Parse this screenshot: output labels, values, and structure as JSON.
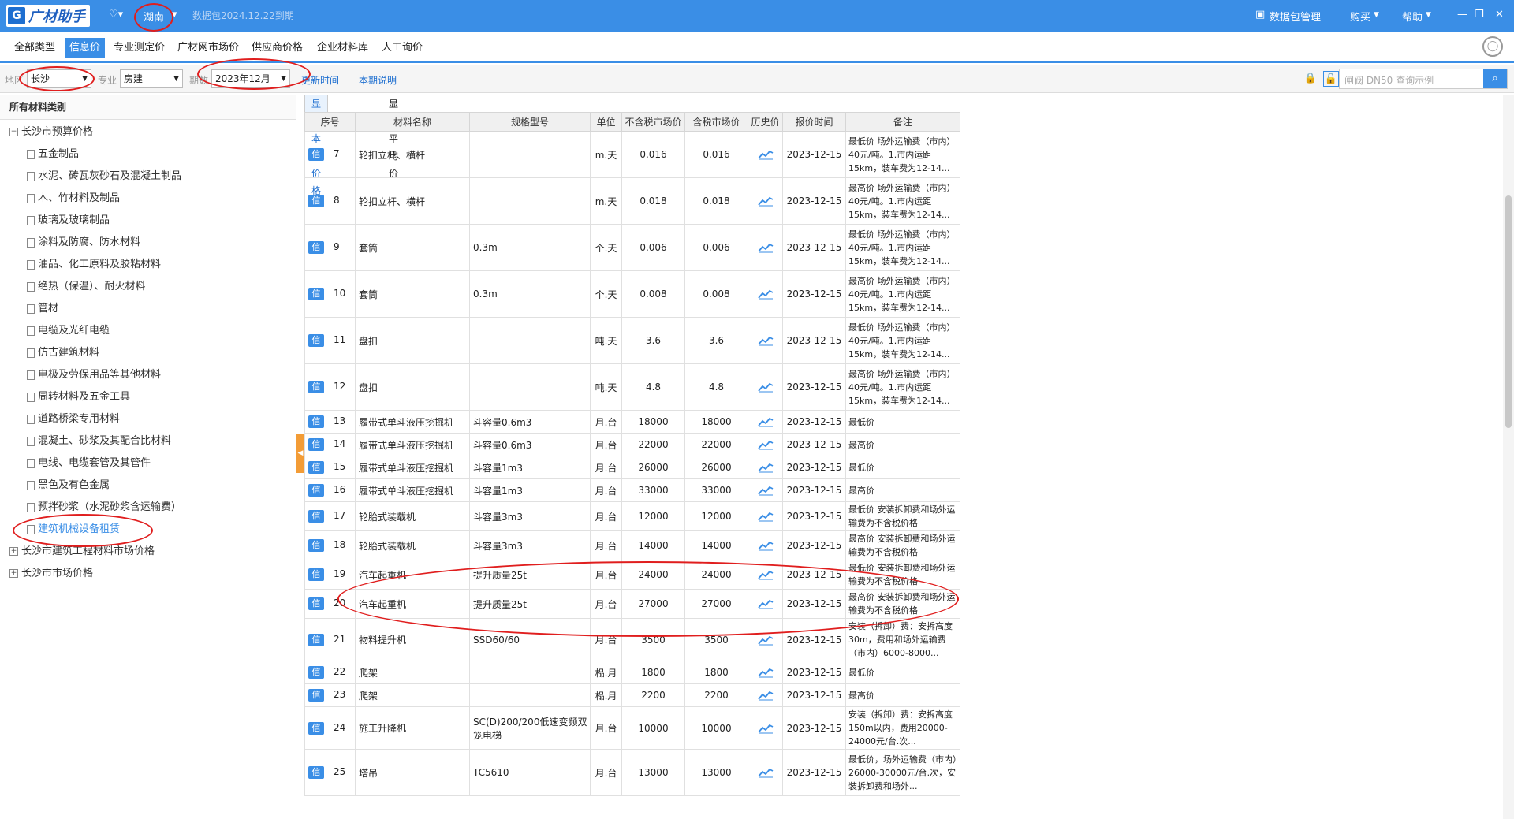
{
  "titlebar": {
    "app_name": "广材助手",
    "province": "湖南",
    "expire_text": "数据包2024.12.22到期",
    "pkg_mgmt": "数据包管理",
    "buy": "购买",
    "help": "帮助"
  },
  "menu": {
    "tabs": [
      {
        "label": "全部类型",
        "active": false
      },
      {
        "label": "信息价",
        "active": true
      },
      {
        "label": "专业测定价",
        "active": false
      },
      {
        "label": "广材网市场价",
        "active": false
      },
      {
        "label": "供应商价格",
        "active": false
      },
      {
        "label": "企业材料库",
        "active": false
      },
      {
        "label": "人工询价",
        "active": false
      }
    ]
  },
  "filters": {
    "region_label": "地区",
    "region_value": "长沙",
    "major_label": "专业",
    "major_value": "房建",
    "period_label": "期数",
    "period_value": "2023年12月",
    "update_time_link": "更新时间",
    "period_note_link": "本期说明",
    "search_placeholder": "闸阀 DN50 查询示例"
  },
  "sidebar": {
    "header": "所有材料类别",
    "root1": "长沙市预算价格",
    "items": [
      "五金制品",
      "水泥、砖瓦灰砂石及混凝土制品",
      "木、竹材料及制品",
      "玻璃及玻璃制品",
      "涂料及防腐、防水材料",
      "油品、化工原料及胶粘材料",
      "绝热（保温）、耐火材料",
      "管材",
      "电缆及光纤电缆",
      "仿古建筑材料",
      "电极及劳保用品等其他材料",
      "周转材料及五金工具",
      "道路桥梁专用材料",
      "混凝土、砂浆及其配合比材料",
      "电线、电缆套管及其管件",
      "黑色及有色金属",
      "预拌砂浆（水泥砂浆含运输费）",
      "建筑机械设备租赁"
    ],
    "selected_index": 17,
    "root2": "长沙市建筑工程材料市场价格",
    "root3": "长沙市市场价格"
  },
  "subtabs": {
    "current": "显示本期价格",
    "average": "显示平均价"
  },
  "table": {
    "headers": [
      "序号",
      "材料名称",
      "规格型号",
      "单位",
      "不含税市场价",
      "含税市场价",
      "历史价",
      "报价时间",
      "备注"
    ],
    "badge": "信",
    "rows": [
      {
        "no": "7",
        "name": "轮扣立杆、横杆",
        "spec": "",
        "unit": "m.天",
        "price_ex": "0.016",
        "price_in": "0.016",
        "date": "2023-12-15",
        "note": "最低价 场外运输费（市内）40元/吨。1.市内运距15km，装车费为12-14..."
      },
      {
        "no": "8",
        "name": "轮扣立杆、横杆",
        "spec": "",
        "unit": "m.天",
        "price_ex": "0.018",
        "price_in": "0.018",
        "date": "2023-12-15",
        "note": "最高价 场外运输费（市内）40元/吨。1.市内运距15km，装车费为12-14..."
      },
      {
        "no": "9",
        "name": "套筒",
        "spec": "0.3m",
        "unit": "个.天",
        "price_ex": "0.006",
        "price_in": "0.006",
        "date": "2023-12-15",
        "note": "最低价 场外运输费（市内）40元/吨。1.市内运距15km，装车费为12-14..."
      },
      {
        "no": "10",
        "name": "套筒",
        "spec": "0.3m",
        "unit": "个.天",
        "price_ex": "0.008",
        "price_in": "0.008",
        "date": "2023-12-15",
        "note": "最高价 场外运输费（市内）40元/吨。1.市内运距15km，装车费为12-14..."
      },
      {
        "no": "11",
        "name": "盘扣",
        "spec": "",
        "unit": "吨.天",
        "price_ex": "3.6",
        "price_in": "3.6",
        "date": "2023-12-15",
        "note": "最低价 场外运输费（市内）40元/吨。1.市内运距15km，装车费为12-14..."
      },
      {
        "no": "12",
        "name": "盘扣",
        "spec": "",
        "unit": "吨.天",
        "price_ex": "4.8",
        "price_in": "4.8",
        "date": "2023-12-15",
        "note": "最高价 场外运输费（市内）40元/吨。1.市内运距15km，装车费为12-14..."
      },
      {
        "no": "13",
        "name": "履带式单斗液压挖掘机",
        "spec": "斗容量0.6m3",
        "unit": "月.台",
        "price_ex": "18000",
        "price_in": "18000",
        "date": "2023-12-15",
        "note": "最低价"
      },
      {
        "no": "14",
        "name": "履带式单斗液压挖掘机",
        "spec": "斗容量0.6m3",
        "unit": "月.台",
        "price_ex": "22000",
        "price_in": "22000",
        "date": "2023-12-15",
        "note": "最高价"
      },
      {
        "no": "15",
        "name": "履带式单斗液压挖掘机",
        "spec": "斗容量1m3",
        "unit": "月.台",
        "price_ex": "26000",
        "price_in": "26000",
        "date": "2023-12-15",
        "note": "最低价"
      },
      {
        "no": "16",
        "name": "履带式单斗液压挖掘机",
        "spec": "斗容量1m3",
        "unit": "月.台",
        "price_ex": "33000",
        "price_in": "33000",
        "date": "2023-12-15",
        "note": "最高价"
      },
      {
        "no": "17",
        "name": "轮胎式装载机",
        "spec": "斗容量3m3",
        "unit": "月.台",
        "price_ex": "12000",
        "price_in": "12000",
        "date": "2023-12-15",
        "note": "最低价 安装拆卸费和场外运输费为不含税价格"
      },
      {
        "no": "18",
        "name": "轮胎式装载机",
        "spec": "斗容量3m3",
        "unit": "月.台",
        "price_ex": "14000",
        "price_in": "14000",
        "date": "2023-12-15",
        "note": "最高价 安装拆卸费和场外运输费为不含税价格"
      },
      {
        "no": "19",
        "name": "汽车起重机",
        "spec": "提升质量25t",
        "unit": "月.台",
        "price_ex": "24000",
        "price_in": "24000",
        "date": "2023-12-15",
        "note": "最低价 安装拆卸费和场外运输费为不含税价格"
      },
      {
        "no": "20",
        "name": "汽车起重机",
        "spec": "提升质量25t",
        "unit": "月.台",
        "price_ex": "27000",
        "price_in": "27000",
        "date": "2023-12-15",
        "note": "最高价 安装拆卸费和场外运输费为不含税价格"
      },
      {
        "no": "21",
        "name": "物料提升机",
        "spec": "SSD60/60",
        "unit": "月.台",
        "price_ex": "3500",
        "price_in": "3500",
        "date": "2023-12-15",
        "note": "安装（拆卸）费：安拆高度30m，费用和场外运输费（市内）6000-8000..."
      },
      {
        "no": "22",
        "name": "爬架",
        "spec": "",
        "unit": "榀.月",
        "price_ex": "1800",
        "price_in": "1800",
        "date": "2023-12-15",
        "note": "最低价"
      },
      {
        "no": "23",
        "name": "爬架",
        "spec": "",
        "unit": "榀.月",
        "price_ex": "2200",
        "price_in": "2200",
        "date": "2023-12-15",
        "note": "最高价"
      },
      {
        "no": "24",
        "name": "施工升降机",
        "spec": "SC(D)200/200低速变频双笼电梯",
        "unit": "月.台",
        "price_ex": "10000",
        "price_in": "10000",
        "date": "2023-12-15",
        "note": "安装（拆卸）费：安拆高度150m以内，费用20000-24000元/台.次..."
      },
      {
        "no": "25",
        "name": "塔吊",
        "spec": "TC5610",
        "unit": "月.台",
        "price_ex": "13000",
        "price_in": "13000",
        "date": "2023-12-15",
        "note": "最低价，场外运输费（市内）26000-30000元/台.次，安装拆卸费和场外..."
      }
    ]
  },
  "colors": {
    "brand": "#3a8ee6",
    "annotation": "#e01e1e"
  }
}
